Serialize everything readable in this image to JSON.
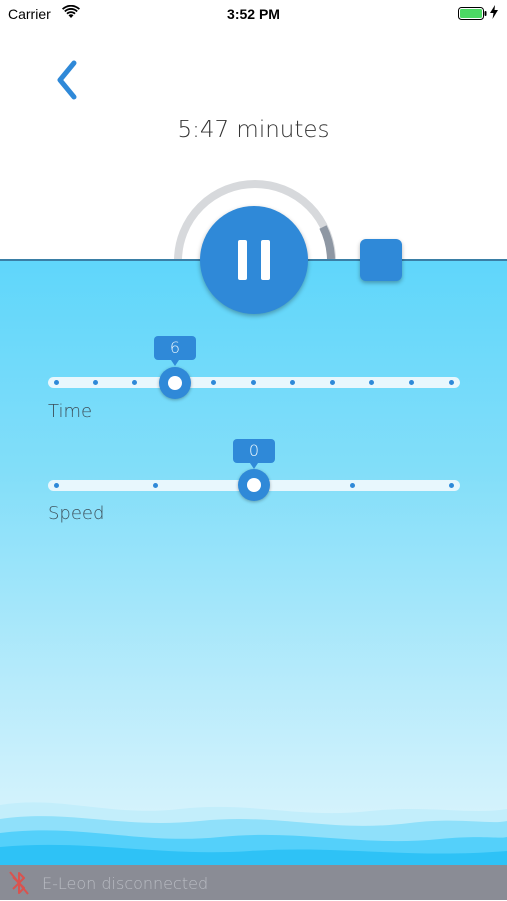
{
  "status_bar": {
    "carrier": "Carrier",
    "time": "3:52 PM",
    "battery_color": "#4cd964"
  },
  "header": {
    "back_icon": "chevron-left-icon",
    "duration": "5:47 minutes"
  },
  "controls": {
    "progress_ring_fraction": 0.78,
    "pause_icon": "pause-icon",
    "stop_icon": "stop-square-icon"
  },
  "sliders": [
    {
      "label": "Time",
      "value": "6",
      "min": 3,
      "max": 13,
      "steps": 11
    },
    {
      "label": "Speed",
      "value": "0",
      "min": -2,
      "max": 2,
      "steps": 5
    }
  ],
  "footer": {
    "status_icon": "bluetooth-disabled-icon",
    "status_text": "E-Leon disconnected"
  },
  "colors": {
    "accent": "#2f89d8",
    "water_top": "#5fd6fb",
    "footer_bg": "#8a8c95",
    "disconnected": "#d9534f"
  }
}
